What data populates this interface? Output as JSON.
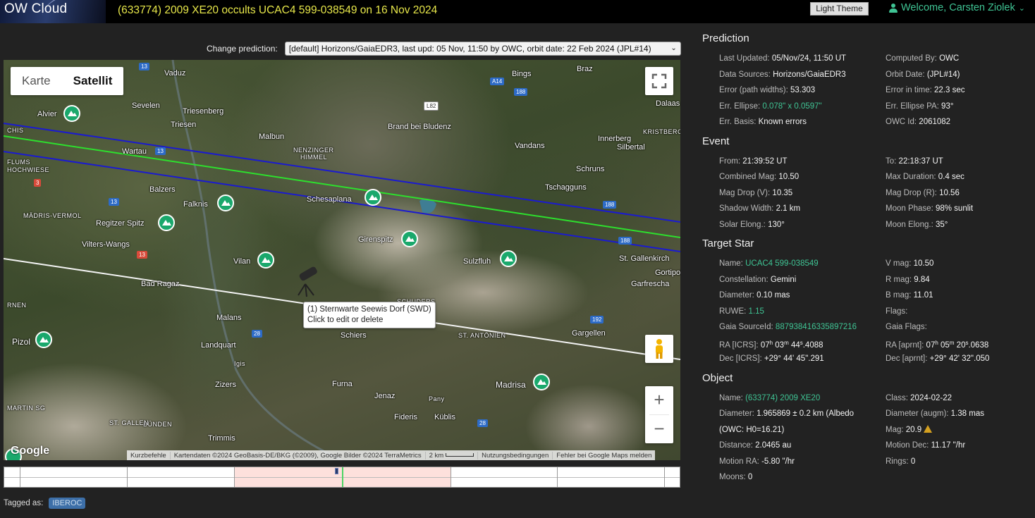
{
  "header": {
    "logo": "OW Cloud",
    "title": "(633774) 2009 XE20 occults UCAC4 599-038549 on 16 Nov 2024",
    "theme_button": "Light Theme",
    "welcome": "Welcome, Carsten Ziolek"
  },
  "prediction_select": {
    "label": "Change prediction:",
    "value": "[default] Horizons/GaiaEDR3, last upd: 05 Nov, 11:50 by OWC, orbit date: 22 Feb 2024 (JPL#14)"
  },
  "map": {
    "type_karte": "Karte",
    "type_satellit": "Satellit",
    "tooltip_line1": "(1) Sternwarte Seewis Dorf (SWD)",
    "tooltip_line2": "Click to edit or delete",
    "google": "Google",
    "footer": {
      "shortcuts": "Kurzbefehle",
      "attribution": "Kartendaten ©2024 GeoBasis-DE/BKG (©2009), Google Bilder ©2024 TerraMetrics",
      "scale": "2 km",
      "terms": "Nutzungsbedingungen",
      "report": "Fehler bei Google Maps melden"
    },
    "places": [
      "Vaduz",
      "Sevelen",
      "Triesenberg",
      "Triesen",
      "Malbun",
      "Wartau",
      "Balzers",
      "Falknis",
      "Brand bei Bludenz",
      "Bings",
      "Braz",
      "Dalaas",
      "Vandans",
      "Innerberg",
      "Silbertal",
      "Schruns",
      "Tschagguns",
      "Schesaplana",
      "Girenspitz",
      "Sulzfluh",
      "St. Gallenkirch",
      "Gortipohl",
      "Garfrescha",
      "Regitzer Spitz",
      "Vilters-Wangs",
      "Vilan",
      "Bad Ragaz",
      "Malans",
      "Schiers",
      "Gargellen",
      "Pizol",
      "Landquart",
      "Igis",
      "Zizers",
      "Furna",
      "Jenaz",
      "Fideris",
      "Küblis",
      "Madrisa",
      "Trimmis",
      "Alvier",
      "Pany"
    ],
    "caps_places": [
      "FLUMS",
      "HOCHWIESE",
      "MÄDRIS-VERMOL",
      "NENZINGER",
      "HIMMEL",
      "KRISTBERG",
      "ST. ANTÖNIEN",
      "SCHUDERS",
      "MARTIN SG",
      "BÜNDEN",
      "CH",
      "RNEN",
      "CHIS",
      "ST. GALLEN"
    ],
    "roads": [
      "13",
      "A14",
      "188",
      "L82",
      "13",
      "3",
      "13",
      "13",
      "188",
      "188",
      "192",
      "28",
      "28"
    ]
  },
  "timeline": {},
  "tags": {
    "label": "Tagged as:",
    "items": [
      "IBEROC"
    ]
  },
  "sections": {
    "prediction": {
      "title": "Prediction",
      "rows": [
        {
          "k": "Last Updated:",
          "v": "05/Nov/24, 11:50 UT"
        },
        {
          "k": "Computed By:",
          "v": "OWC"
        },
        {
          "k": "Data Sources:",
          "v": "Horizons/GaiaEDR3"
        },
        {
          "k": "Orbit Date:",
          "v": "(JPL#14)"
        },
        {
          "k": "Error (path widths):",
          "v": "53.303"
        },
        {
          "k": "Error in time:",
          "v": "22.3 sec"
        },
        {
          "k": "Err. Ellipse:",
          "v": "0.078\" x 0.0597\""
        },
        {
          "k": "Err. Ellipse PA:",
          "v": "93°"
        },
        {
          "k": "Err. Basis:",
          "v": "Known errors"
        },
        {
          "k": "OWC Id:",
          "v": "2061082"
        }
      ]
    },
    "event": {
      "title": "Event",
      "rows": [
        {
          "k": "From:",
          "v": "21:39:52 UT"
        },
        {
          "k": "To:",
          "v": "22:18:37 UT"
        },
        {
          "k": "Combined Mag:",
          "v": "10.50"
        },
        {
          "k": "Max Duration:",
          "v": "0.4 sec"
        },
        {
          "k": "Mag Drop (V):",
          "v": "10.35"
        },
        {
          "k": "Mag Drop (R):",
          "v": "10.56"
        },
        {
          "k": "Shadow Width:",
          "v": "2.1 km"
        },
        {
          "k": "Moon Phase:",
          "v": "98% sunlit"
        },
        {
          "k": "Solar Elong.:",
          "v": "130°"
        },
        {
          "k": "Moon Elong.:",
          "v": "35°"
        }
      ]
    },
    "star": {
      "title": "Target Star",
      "rows": [
        {
          "k": "Name:",
          "v": "UCAC4 599-038549"
        },
        {
          "k": "V mag:",
          "v": "10.50"
        },
        {
          "k": "Constellation:",
          "v": "Gemini"
        },
        {
          "k": "R mag:",
          "v": "9.84"
        },
        {
          "k": "Diameter:",
          "v": "0.10 mas"
        },
        {
          "k": "B mag:",
          "v": "11.01"
        },
        {
          "k": "RUWE:",
          "v": "1.15"
        },
        {
          "k": "Flags:",
          "v": ""
        },
        {
          "k": "Gaia SourceId:",
          "v": "887938416335897216"
        },
        {
          "k": "Gaia Flags:",
          "v": ""
        },
        {
          "k": "RA [ICRS]:",
          "h": "07",
          "m": "03",
          "s": "44",
          "f": ".4088"
        },
        {
          "k": "RA [aprnt]:",
          "h": "07",
          "m": "05",
          "s": "20",
          "f": ".0638"
        },
        {
          "k": "Dec [ICRS]:",
          "v": "+29° 44' 45\".291"
        },
        {
          "k": "Dec [aprnt]:",
          "v": "+29° 42' 32\".050"
        }
      ]
    },
    "object": {
      "title": "Object",
      "rows": [
        {
          "k": "Name:",
          "v": "(633774) 2009 XE20"
        },
        {
          "k": "Class:",
          "v": "2024-02-22"
        },
        {
          "k": "Diameter:",
          "v": "1.965869 ± 0.2 km (Albedo"
        },
        {
          "k": "Diameter (augm):",
          "v": "1.38 mas"
        },
        {
          "k": "",
          "v": "(OWC: H0=16.21)"
        },
        {
          "k": "Mag:",
          "v": "20.9"
        },
        {
          "k": "Distance:",
          "v": "2.0465 au"
        },
        {
          "k": "Motion Dec:",
          "v": "11.17 \"/hr"
        },
        {
          "k": "Motion RA:",
          "v": "-5.80 \"/hr"
        },
        {
          "k": "Rings:",
          "v": "0"
        },
        {
          "k": "Moons:",
          "v": "0"
        }
      ]
    }
  }
}
